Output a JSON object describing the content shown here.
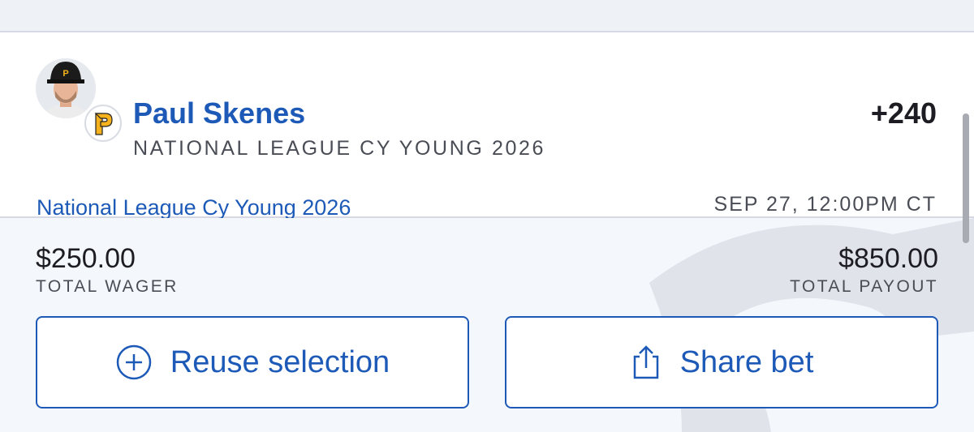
{
  "bet": {
    "player_name": "Paul Skenes",
    "market": "NATIONAL LEAGUE CY YOUNG 2026",
    "odds": "+240",
    "event_name": "National League Cy Young 2026",
    "event_datetime": "SEP 27, 12:00PM CT",
    "team_logo_letter": "P"
  },
  "totals": {
    "wager_amount": "$250.00",
    "wager_label": "TOTAL WAGER",
    "payout_amount": "$850.00",
    "payout_label": "TOTAL PAYOUT"
  },
  "actions": {
    "reuse_label": "Reuse selection",
    "reuse_icon": "plus-circle-icon",
    "share_label": "Share bet",
    "share_icon": "share-icon"
  },
  "colors": {
    "accent_blue": "#1d5ab8",
    "team_gold": "#f6b21c"
  }
}
